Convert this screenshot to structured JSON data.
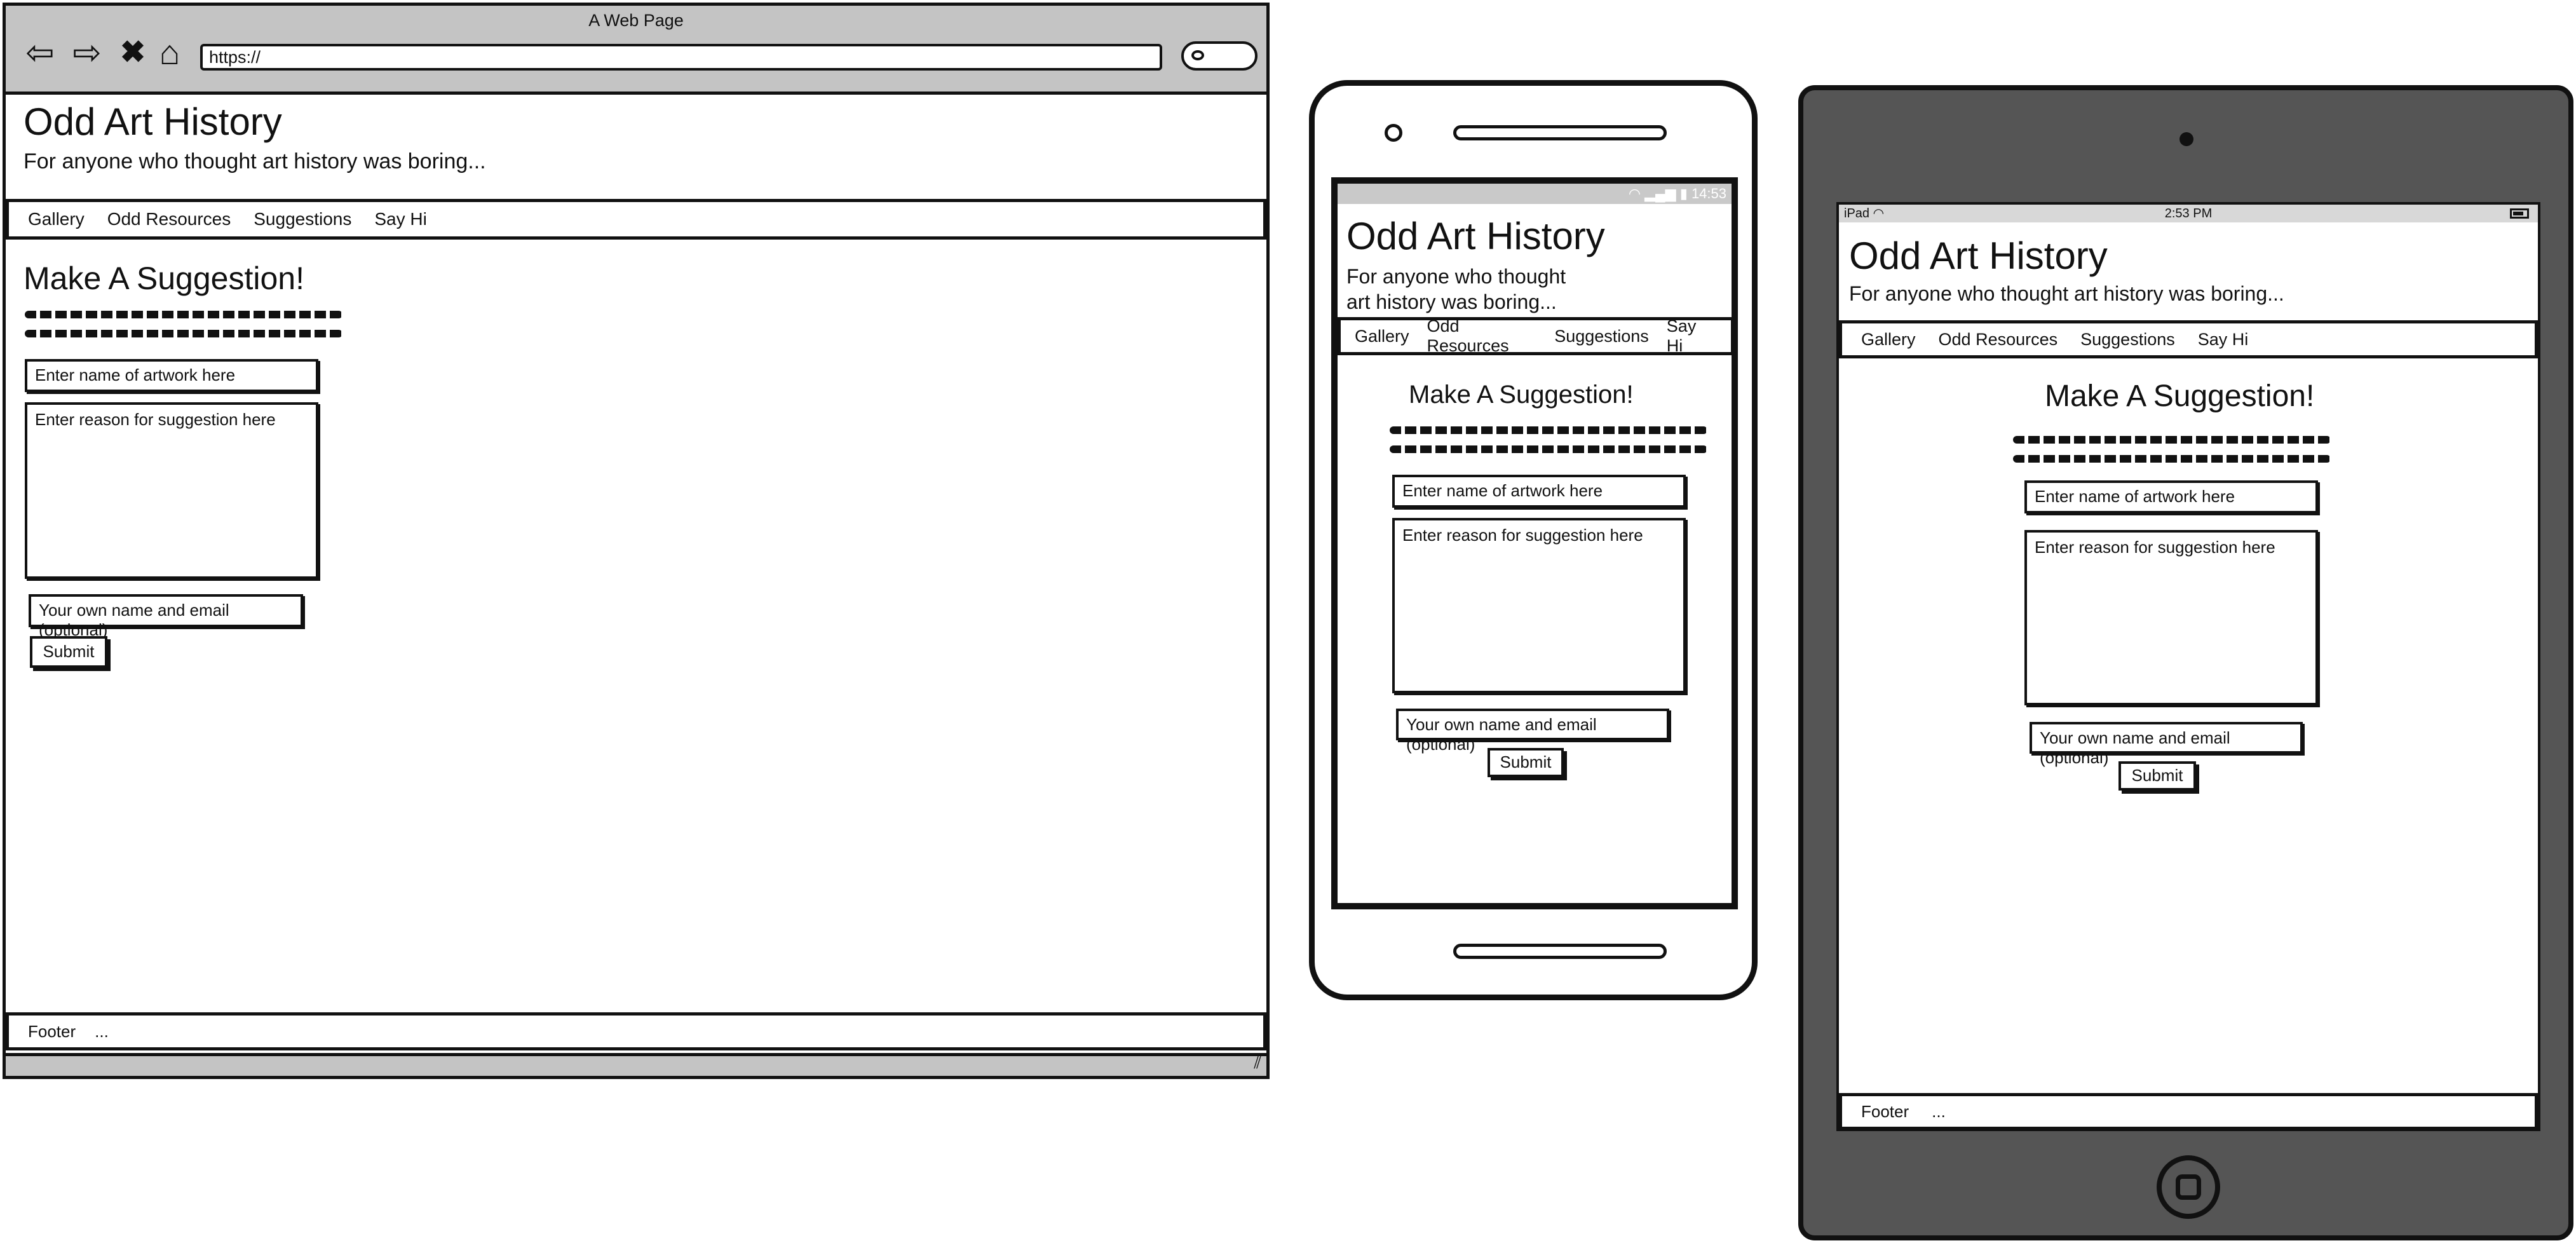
{
  "browser": {
    "window_title": "A Web Page",
    "url": "https://",
    "nav_icons": [
      "back-arrow-icon",
      "forward-arrow-icon",
      "stop-x-icon",
      "home-icon",
      "search-icon"
    ]
  },
  "site": {
    "title": "Odd Art History",
    "subtitle": "For anyone who thought art history was boring...",
    "subtitle_phone_line1": "For anyone who thought",
    "subtitle_phone_line2": "art history was boring...",
    "nav": [
      "Gallery",
      "Odd Resources",
      "Suggestions",
      "Say Hi"
    ]
  },
  "form": {
    "heading": "Make A Suggestion!",
    "artwork_placeholder": "Enter name of artwork here",
    "reason_placeholder": "Enter reason for suggestion here",
    "email_placeholder": "Your own name and email (optional)",
    "submit_label": "Submit"
  },
  "footer": {
    "label": "Footer",
    "ellipsis": "..."
  },
  "phone": {
    "status_time": "14:53"
  },
  "tablet": {
    "carrier": "iPad",
    "status_time": "2:53 PM"
  }
}
